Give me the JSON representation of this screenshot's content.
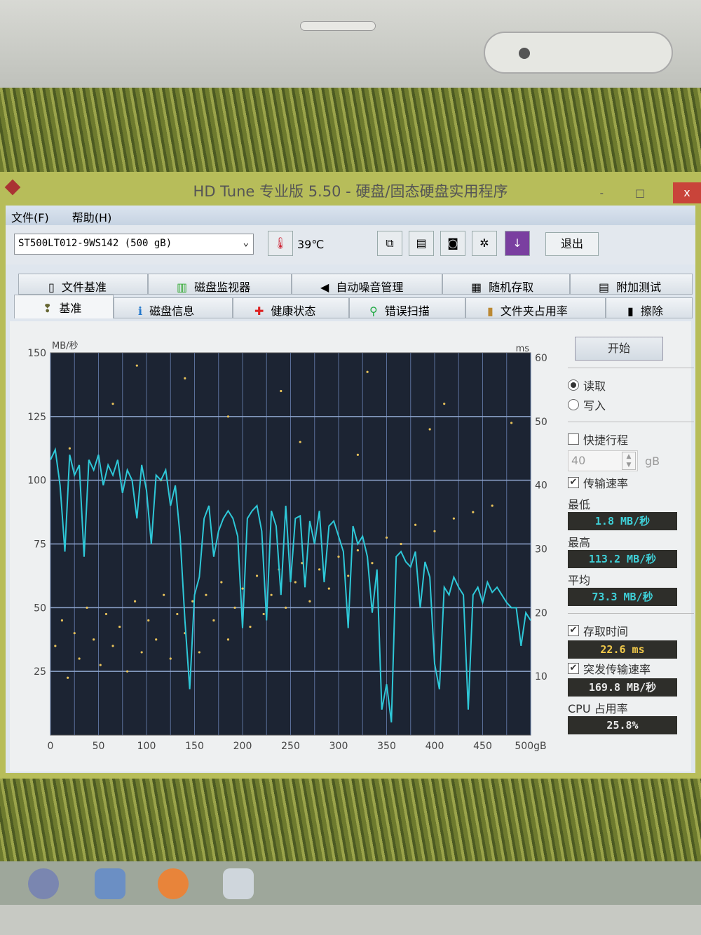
{
  "window": {
    "title": "HD Tune 专业版 5.50 - 硬盘/固态硬盘实用程序",
    "close": "x",
    "minmax": "- □"
  },
  "menu": [
    "文件(F)",
    "帮助(H)"
  ],
  "toolbar": {
    "drive": "ST500LT012-9WS142 (500 gB)",
    "temperature": "39℃",
    "exit": "退出"
  },
  "tabs_top": [
    {
      "label": "文件基准",
      "icon": "file-benchmark-icon"
    },
    {
      "label": "磁盘监视器",
      "icon": "disk-monitor-icon"
    },
    {
      "label": "自动噪音管理",
      "icon": "speaker-icon"
    },
    {
      "label": "随机存取",
      "icon": "random-access-icon"
    },
    {
      "label": "附加测试",
      "icon": "extra-tests-icon"
    }
  ],
  "tabs_bottom": [
    {
      "label": "基准",
      "icon": "benchmark-icon"
    },
    {
      "label": "磁盘信息",
      "icon": "info-icon"
    },
    {
      "label": "健康状态",
      "icon": "health-cross-icon"
    },
    {
      "label": "错误扫描",
      "icon": "magnifier-icon"
    },
    {
      "label": "文件夹占用率",
      "icon": "folder-icon"
    },
    {
      "label": "擦除",
      "icon": "trash-icon"
    }
  ],
  "side": {
    "start": "开始",
    "read": "读取",
    "write": "写入",
    "short_stroke": "快捷行程",
    "stroke_value": "40",
    "stroke_unit": "gB",
    "transfer_rate": "传输速率",
    "min_label": "最低",
    "min": "1.8 MB/秒",
    "max_label": "最高",
    "max": "113.2 MB/秒",
    "avg_label": "平均",
    "avg": "73.3 MB/秒",
    "access_label": "存取时间",
    "access": "22.6 ms",
    "burst_label": "突发传输速率",
    "burst": "169.8 MB/秒",
    "cpu_label": "CPU 占用率",
    "cpu": "25.8%"
  },
  "colors": {
    "line": "#2ec8d8",
    "dots": "#e8c25a",
    "plot_bg": "#1c2433",
    "lcd_cyan": "#3fd0d8",
    "lcd_yellow": "#f0c84a",
    "lcd_white": "#e8e8e8"
  },
  "chart_data": {
    "type": "line",
    "title": "",
    "ylabel": "MB/秒",
    "y2label": "ms",
    "xlabel": "gB",
    "xlim": [
      0,
      500
    ],
    "ylim": [
      0,
      150
    ],
    "y2lim": [
      0,
      60
    ],
    "xticks": [
      "0",
      "50",
      "100",
      "150",
      "200",
      "250",
      "300",
      "350",
      "400",
      "450",
      "500gB"
    ],
    "yticks": [
      "25",
      "50",
      "75",
      "100",
      "125",
      "150"
    ],
    "y2ticks": [
      "10",
      "20",
      "30",
      "40",
      "50",
      "60"
    ],
    "series": [
      {
        "name": "传输速率",
        "x_step": 5,
        "values": [
          108,
          112,
          98,
          72,
          110,
          102,
          106,
          70,
          108,
          104,
          110,
          98,
          106,
          102,
          108,
          95,
          104,
          100,
          85,
          106,
          96,
          75,
          102,
          100,
          104,
          90,
          98,
          78,
          45,
          18,
          55,
          62,
          85,
          90,
          70,
          80,
          85,
          88,
          85,
          78,
          42,
          85,
          88,
          90,
          80,
          45,
          88,
          82,
          55,
          90,
          60,
          85,
          86,
          58,
          84,
          75,
          88,
          60,
          82,
          84,
          78,
          72,
          42,
          82,
          75,
          78,
          70,
          48,
          65,
          10,
          20,
          5,
          70,
          72,
          68,
          66,
          72,
          50,
          68,
          62,
          28,
          18,
          58,
          55,
          62,
          58,
          55,
          10,
          55,
          58,
          52,
          60,
          56,
          58,
          55,
          52,
          50,
          50,
          35,
          48,
          45
        ]
      },
      {
        "name": "存取时间",
        "type": "scatter",
        "points": [
          [
            5,
            14
          ],
          [
            12,
            18
          ],
          [
            18,
            9
          ],
          [
            25,
            16
          ],
          [
            30,
            12
          ],
          [
            38,
            20
          ],
          [
            45,
            15
          ],
          [
            52,
            11
          ],
          [
            58,
            19
          ],
          [
            65,
            14
          ],
          [
            72,
            17
          ],
          [
            80,
            10
          ],
          [
            88,
            21
          ],
          [
            95,
            13
          ],
          [
            102,
            18
          ],
          [
            110,
            15
          ],
          [
            118,
            22
          ],
          [
            125,
            12
          ],
          [
            132,
            19
          ],
          [
            140,
            16
          ],
          [
            148,
            21
          ],
          [
            155,
            13
          ],
          [
            162,
            22
          ],
          [
            170,
            18
          ],
          [
            178,
            24
          ],
          [
            185,
            15
          ],
          [
            192,
            20
          ],
          [
            200,
            23
          ],
          [
            208,
            17
          ],
          [
            215,
            25
          ],
          [
            222,
            19
          ],
          [
            230,
            22
          ],
          [
            238,
            26
          ],
          [
            245,
            20
          ],
          [
            255,
            24
          ],
          [
            262,
            27
          ],
          [
            270,
            21
          ],
          [
            280,
            26
          ],
          [
            290,
            23
          ],
          [
            300,
            28
          ],
          [
            310,
            25
          ],
          [
            320,
            29
          ],
          [
            335,
            27
          ],
          [
            350,
            31
          ],
          [
            365,
            30
          ],
          [
            380,
            33
          ],
          [
            400,
            32
          ],
          [
            420,
            34
          ],
          [
            440,
            35
          ],
          [
            460,
            36
          ],
          [
            20,
            45
          ],
          [
            90,
            58
          ],
          [
            140,
            56
          ],
          [
            185,
            50
          ],
          [
            240,
            54
          ],
          [
            260,
            46
          ],
          [
            320,
            44
          ],
          [
            330,
            57
          ],
          [
            395,
            48
          ],
          [
            410,
            52
          ],
          [
            480,
            49
          ],
          [
            115,
            40
          ],
          [
            65,
            52
          ]
        ]
      }
    ]
  }
}
